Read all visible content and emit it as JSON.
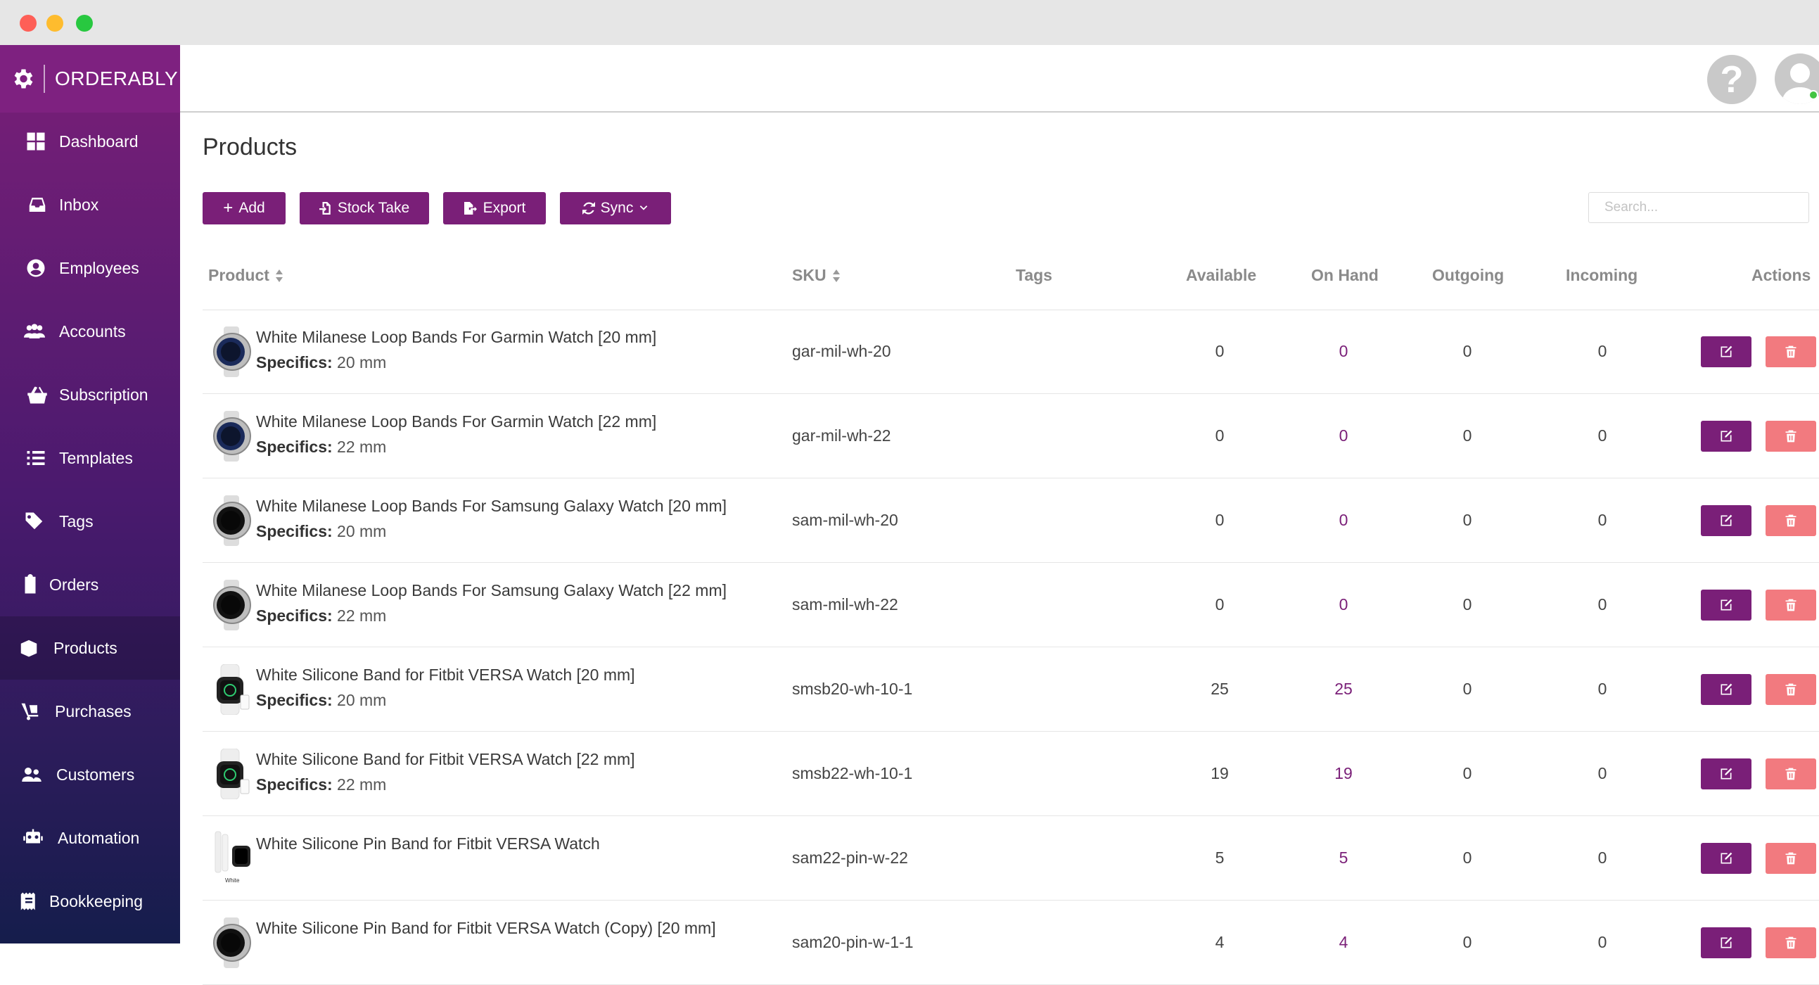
{
  "app": {
    "brand": "ORDERABLY"
  },
  "colors": {
    "accent": "#7a1f78",
    "danger": "#f27a7f",
    "online": "#43c443"
  },
  "sidebar": {
    "items": [
      {
        "label": "Dashboard",
        "icon": "dashboard-icon"
      },
      {
        "label": "Inbox",
        "icon": "inbox-icon"
      },
      {
        "label": "Employees",
        "icon": "user-circle-icon"
      },
      {
        "label": "Accounts",
        "icon": "users-icon"
      },
      {
        "label": "Subscription",
        "icon": "basket-icon"
      },
      {
        "label": "Templates",
        "icon": "list-icon"
      },
      {
        "label": "Tags",
        "icon": "tags-icon"
      },
      {
        "label": "Orders",
        "icon": "clipboard-icon"
      },
      {
        "label": "Products",
        "icon": "box-icon",
        "active": true
      },
      {
        "label": "Purchases",
        "icon": "dolly-icon"
      },
      {
        "label": "Customers",
        "icon": "user-friends-icon"
      },
      {
        "label": "Automation",
        "icon": "robot-icon"
      },
      {
        "label": "Bookkeeping",
        "icon": "receipt-icon"
      }
    ]
  },
  "header": {
    "help_icon": "question-icon",
    "avatar_icon": "user-avatar-icon"
  },
  "page": {
    "title": "Products"
  },
  "toolbar": {
    "add_label": "Add",
    "stocktake_label": "Stock Take",
    "export_label": "Export",
    "sync_label": "Sync",
    "search_placeholder": "Search..."
  },
  "table": {
    "columns": {
      "product": "Product",
      "sku": "SKU",
      "tags": "Tags",
      "available": "Available",
      "on_hand": "On Hand",
      "outgoing": "Outgoing",
      "incoming": "Incoming",
      "actions": "Actions"
    },
    "spec_label": "Specifics:",
    "rows": [
      {
        "name": "White Milanese Loop Bands For Garmin Watch [20 mm]",
        "spec": "20 mm",
        "sku": "gar-mil-wh-20",
        "available": "0",
        "on_hand": "0",
        "outgoing": "0",
        "incoming": "0",
        "thumb": "garmin"
      },
      {
        "name": "White Milanese Loop Bands For Garmin Watch [22 mm]",
        "spec": "22 mm",
        "sku": "gar-mil-wh-22",
        "available": "0",
        "on_hand": "0",
        "outgoing": "0",
        "incoming": "0",
        "thumb": "garmin"
      },
      {
        "name": "White Milanese Loop Bands For Samsung Galaxy Watch [20 mm]",
        "spec": "20 mm",
        "sku": "sam-mil-wh-20",
        "available": "0",
        "on_hand": "0",
        "outgoing": "0",
        "incoming": "0",
        "thumb": "samsung"
      },
      {
        "name": "White Milanese Loop Bands For Samsung Galaxy Watch [22 mm]",
        "spec": "22 mm",
        "sku": "sam-mil-wh-22",
        "available": "0",
        "on_hand": "0",
        "outgoing": "0",
        "incoming": "0",
        "thumb": "samsung"
      },
      {
        "name": "White Silicone Band for Fitbit VERSA Watch [20 mm]",
        "spec": "20 mm",
        "sku": "smsb20-wh-10-1",
        "available": "25",
        "on_hand": "25",
        "outgoing": "0",
        "incoming": "0",
        "thumb": "fitbit"
      },
      {
        "name": "White Silicone Band for Fitbit VERSA Watch [22 mm]",
        "spec": "22 mm",
        "sku": "smsb22-wh-10-1",
        "available": "19",
        "on_hand": "19",
        "outgoing": "0",
        "incoming": "0",
        "thumb": "fitbit"
      },
      {
        "name": "White Silicone Pin Band for Fitbit VERSA Watch",
        "spec": "",
        "sku": "sam22-pin-w-22",
        "available": "5",
        "on_hand": "5",
        "outgoing": "0",
        "incoming": "0",
        "thumb": "versa",
        "thumb_caption": "White"
      },
      {
        "name": "White Silicone Pin Band for Fitbit VERSA Watch (Copy) [20 mm]",
        "spec": "",
        "sku": "sam20-pin-w-1-1",
        "available": "4",
        "on_hand": "4",
        "outgoing": "0",
        "incoming": "0",
        "thumb": "samsung"
      }
    ]
  }
}
